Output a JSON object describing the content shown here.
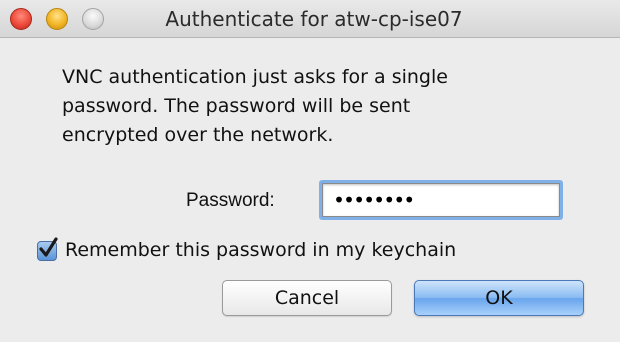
{
  "window": {
    "title": "Authenticate for atw-cp-ise07",
    "controls": {
      "close": "close-button",
      "minimize": "minimize-button",
      "zoom": "zoom-button"
    }
  },
  "message": {
    "lines": [
      "VNC authentication just asks for a single",
      "password. The password will be sent",
      "encrypted over the network."
    ]
  },
  "password": {
    "label": "Password:",
    "masked_value": "••••••••"
  },
  "remember": {
    "label": "Remember this password in my keychain",
    "checked": true
  },
  "buttons": {
    "cancel_label": "Cancel",
    "ok_label": "OK"
  },
  "colors": {
    "window_background": "#ececec",
    "focus_ring": "#7fb0e8",
    "default_button": "#6aa5ec",
    "checkbox_accent": "#5b93d6"
  }
}
